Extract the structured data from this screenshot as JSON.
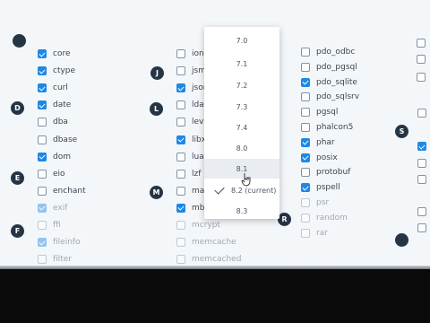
{
  "columns": {
    "c1": [
      {
        "label": "core",
        "checked": true
      },
      {
        "label": "ctype",
        "checked": true
      },
      {
        "label": "curl",
        "checked": true
      },
      {
        "label": "date",
        "checked": true
      },
      {
        "label": "dba",
        "checked": false
      },
      {
        "label": "dbase",
        "checked": false
      },
      {
        "label": "dom",
        "checked": true
      },
      {
        "label": "eio",
        "checked": false
      },
      {
        "label": "enchant",
        "checked": false
      },
      {
        "label": "exif",
        "checked": true
      },
      {
        "label": "ffi",
        "checked": false
      },
      {
        "label": "fileinfo",
        "checked": true
      },
      {
        "label": "filter",
        "checked": false
      }
    ],
    "c2": [
      {
        "label": "ioncu",
        "checked": false
      },
      {
        "label": "jsmin",
        "checked": false
      },
      {
        "label": "json",
        "checked": true
      },
      {
        "label": "ldap",
        "checked": false
      },
      {
        "label": "levelc",
        "checked": false
      },
      {
        "label": "libxm",
        "checked": true
      },
      {
        "label": "luasa",
        "checked": false
      },
      {
        "label": "lzf",
        "checked": false
      },
      {
        "label": "mailp",
        "checked": false
      },
      {
        "label": "mbstr",
        "checked": true
      },
      {
        "label": "mcrypt",
        "checked": false
      },
      {
        "label": "memcache",
        "checked": false
      },
      {
        "label": "memcached",
        "checked": false
      }
    ],
    "c3": [
      {
        "label": "pdo_odbc",
        "checked": false
      },
      {
        "label": "pdo_pgsql",
        "checked": false
      },
      {
        "label": "pdo_sqlite",
        "checked": true
      },
      {
        "label": "pdo_sqlsrv",
        "checked": false
      },
      {
        "label": "pgsql",
        "checked": false
      },
      {
        "label": "phalcon5",
        "checked": false
      },
      {
        "label": "phar",
        "checked": true
      },
      {
        "label": "posix",
        "checked": true
      },
      {
        "label": "protobuf",
        "checked": false
      },
      {
        "label": "pspell",
        "checked": true
      },
      {
        "label": "psr",
        "checked": false
      },
      {
        "label": "random",
        "checked": false
      },
      {
        "label": "rar",
        "checked": false
      }
    ]
  },
  "letters": [
    "D",
    "E",
    "F",
    "J",
    "L",
    "M",
    "R",
    "S"
  ],
  "dropdown": {
    "options": [
      "7.0",
      "7.1",
      "7.2",
      "7.3",
      "7.4",
      "8.0",
      "8.1",
      "8.2 (current)",
      "8.3"
    ],
    "hovered": "8.1",
    "selected": "8.2 (current)"
  },
  "colors": {
    "accent": "#1e88e5",
    "letter_bg": "#263545"
  }
}
